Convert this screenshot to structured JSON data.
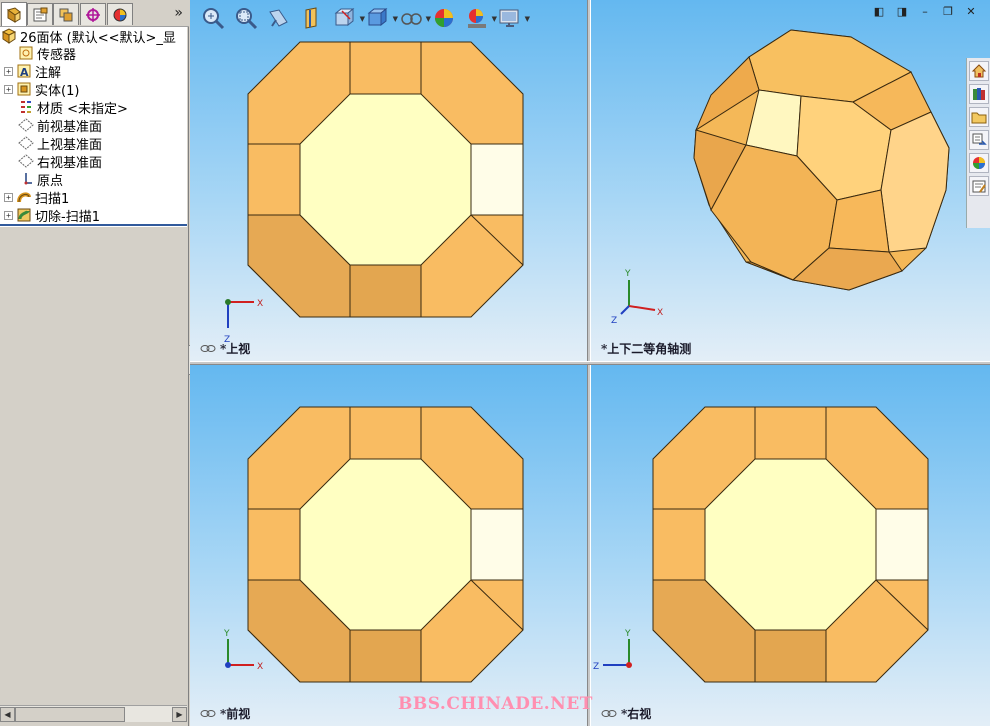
{
  "feature_tree": {
    "root": "26面体 (默认<<默认>_显",
    "items": [
      {
        "label": "传感器",
        "expandable": false,
        "icon": "sensor-icon"
      },
      {
        "label": "注解",
        "expandable": true,
        "icon": "annotation-icon"
      },
      {
        "label": "实体(1)",
        "expandable": true,
        "icon": "solid-body-icon"
      },
      {
        "label": "材质 <未指定>",
        "expandable": false,
        "icon": "material-icon"
      },
      {
        "label": "前视基准面",
        "expandable": false,
        "icon": "plane-icon"
      },
      {
        "label": "上视基准面",
        "expandable": false,
        "icon": "plane-icon"
      },
      {
        "label": "右视基准面",
        "expandable": false,
        "icon": "plane-icon"
      },
      {
        "label": "原点",
        "expandable": false,
        "icon": "origin-icon"
      },
      {
        "label": "扫描1",
        "expandable": true,
        "icon": "sweep-icon"
      },
      {
        "label": "切除-扫描1",
        "expandable": true,
        "icon": "cut-sweep-icon"
      }
    ]
  },
  "panel_tabs": [
    "feature-manager-tab",
    "property-manager-tab",
    "configuration-manager-tab",
    "dimxpert-tab",
    "display-manager-tab"
  ],
  "panel_more": "»",
  "toolbar": {
    "icons": [
      "zoom-to-fit-icon",
      "zoom-to-area-icon",
      "previous-view-icon",
      "section-view-icon",
      "view-orientation-icon",
      "display-style-icon",
      "hide-show-items-icon",
      "edit-appearance-icon",
      "apply-scene-icon",
      "view-settings-icon"
    ]
  },
  "window_controls": [
    "◧",
    "◨",
    "–",
    "❐",
    "✕"
  ],
  "viewports": {
    "top": {
      "label": "*上视",
      "axes": {
        "h": "X",
        "v": "Z"
      }
    },
    "iso": {
      "label": "*上下二等角轴测",
      "axes": {
        "a": "Y",
        "b": "X",
        "c": "Z"
      }
    },
    "front": {
      "label": "*前视",
      "axes": {
        "h": "X",
        "v": "Y"
      }
    },
    "right": {
      "label": "*右视",
      "axes": {
        "h": "Z",
        "v": "Y"
      }
    }
  },
  "task_pane": [
    "home-icon",
    "design-library-icon",
    "file-explorer-icon",
    "view-palette-icon",
    "appearances-icon",
    "custom-properties-icon"
  ],
  "colors": {
    "face_light": "#ffffc2",
    "face_orange": "#f9bc62",
    "face_dark": "#e6a954",
    "face_white": "#fffde8",
    "viewport_top": "#64b8f0",
    "tree_selection_line": "#315a9c"
  },
  "watermark": "BBS.CHINADE.NET"
}
